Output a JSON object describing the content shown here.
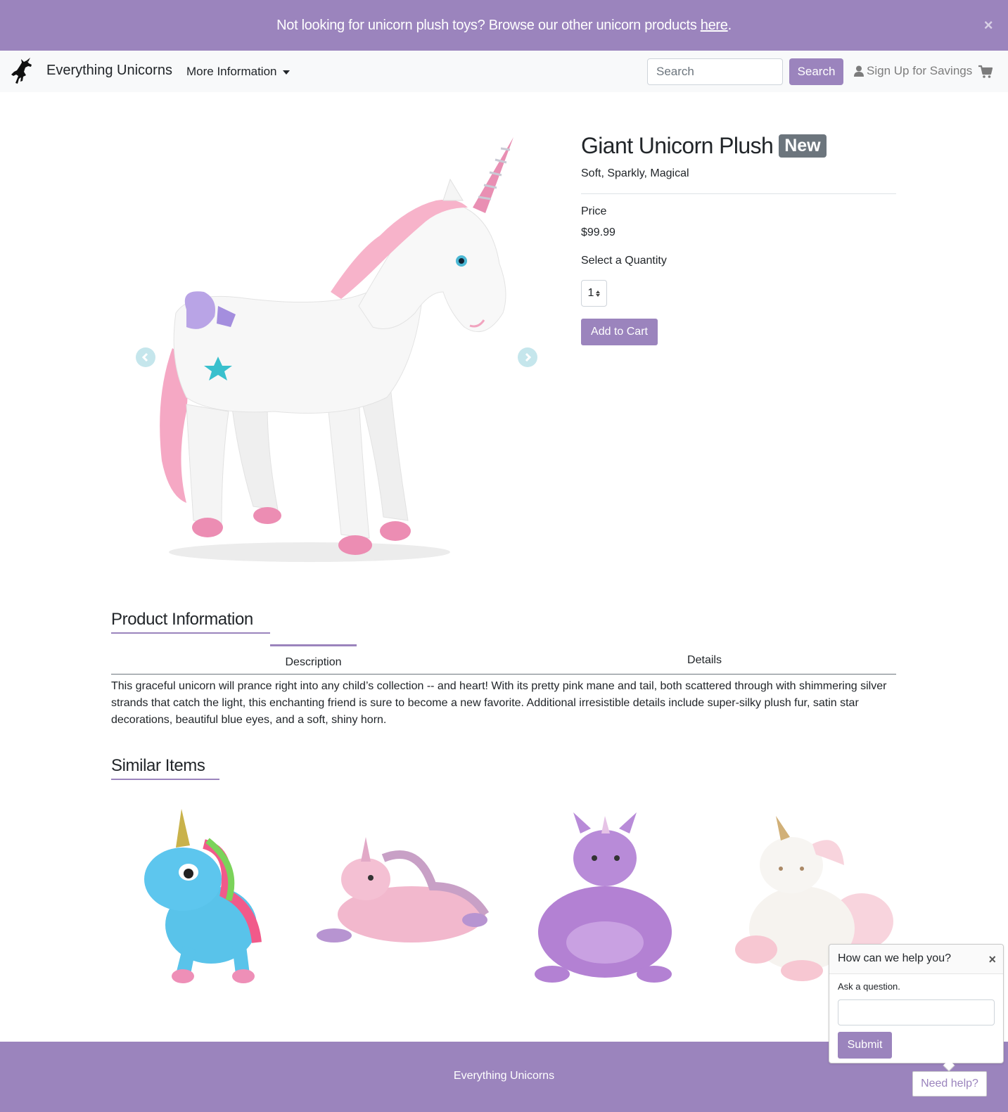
{
  "banner": {
    "text": "Not looking for unicorn plush toys? Browse our other unicorn products ",
    "link_text": "here",
    "suffix": ".",
    "close_glyph": "×"
  },
  "nav": {
    "brand": "Everything Unicorns",
    "more_info": "More Information",
    "search_placeholder": "Search",
    "search_button": "Search",
    "signup": "Sign Up for Savings"
  },
  "product": {
    "title": "Giant Unicorn Plush",
    "badge": "New",
    "tagline": "Soft, Sparkly, Magical",
    "price_label": "Price",
    "price": "$99.99",
    "quantity_label": "Select a Quantity",
    "quantity": "1",
    "add_to_cart": "Add to Cart"
  },
  "info": {
    "heading": "Product Information",
    "tabs": [
      {
        "label": "Description",
        "active": true
      },
      {
        "label": "Details",
        "active": false
      }
    ],
    "description": "This graceful unicorn will prance right into any child’s collection -- and heart! With its pretty pink mane and tail, both scattered through with shimmering silver strands that catch the light, this enchanting friend is sure to become a new favorite. Additional irresistible details include super-silky plush fur, satin star decorations, beautiful blue eyes, and a soft, shiny horn."
  },
  "similar": {
    "heading": "Similar Items",
    "items": [
      {
        "icon": "blue-unicorn-plush"
      },
      {
        "icon": "pink-lying-unicorn-plush"
      },
      {
        "icon": "purple-unicorn-chair"
      },
      {
        "icon": "white-sitting-unicorn-plush"
      }
    ]
  },
  "help": {
    "title": "How can we help you?",
    "close_glyph": "×",
    "hint": "Ask a question.",
    "submit": "Submit",
    "need_help": "Need help?"
  },
  "footer": {
    "text": "Everything Unicorns"
  },
  "colors": {
    "accent": "#9b84bd",
    "badge": "#6c757d",
    "arrow": "#c5e6ec"
  }
}
